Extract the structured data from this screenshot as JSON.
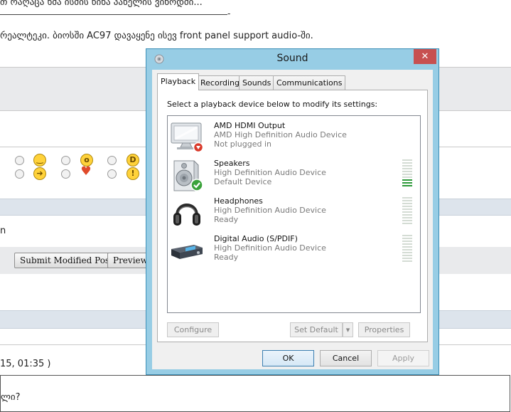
{
  "background_page": {
    "line1": "თ რაღაცა ხმა ისმის წინა პანელის ვინოდმი...",
    "line2": "რეალტეკი. ბიოსში AC97 დავაყენე ისევ front panel support audio-ში.",
    "row_text_n": "n",
    "submit_label": "Submit Modified Post",
    "preview_label": "Preview",
    "timestamp": "15, 01:35 )",
    "bottom_text": "ლი?",
    "separator_dash": "-"
  },
  "dialog": {
    "title": "Sound",
    "close_glyph": "✕",
    "tabs": [
      {
        "label": "Playback",
        "active": true
      },
      {
        "label": "Recording",
        "active": false
      },
      {
        "label": "Sounds",
        "active": false
      },
      {
        "label": "Communications",
        "active": false
      }
    ],
    "instruction": "Select a playback device below to modify its settings:",
    "devices": [
      {
        "name": "AMD HDMI Output",
        "description": "AMD High Definition Audio Device",
        "status": "Not plugged in",
        "icon": "monitor-icon",
        "badge": "red-down-arrow",
        "level": 0
      },
      {
        "name": "Speakers",
        "description": "High Definition Audio Device",
        "status": "Default Device",
        "icon": "speaker-icon",
        "badge": "green-check",
        "level": 0.3
      },
      {
        "name": "Headphones",
        "description": "High Definition Audio Device",
        "status": "Ready",
        "icon": "headphones-icon",
        "badge": "",
        "level": 0
      },
      {
        "name": "Digital Audio (S/PDIF)",
        "description": "High Definition Audio Device",
        "status": "Ready",
        "icon": "digital-audio-device-icon",
        "badge": "",
        "level": 0
      }
    ],
    "panel_buttons": {
      "configure": "Configure",
      "set_default": "Set Default",
      "properties": "Properties"
    },
    "dialog_buttons": {
      "ok": "OK",
      "cancel": "Cancel",
      "apply": "Apply"
    },
    "colors": {
      "frame": "#97cde5",
      "close": "#c75050",
      "meter_active": "#2e9a3a"
    }
  }
}
